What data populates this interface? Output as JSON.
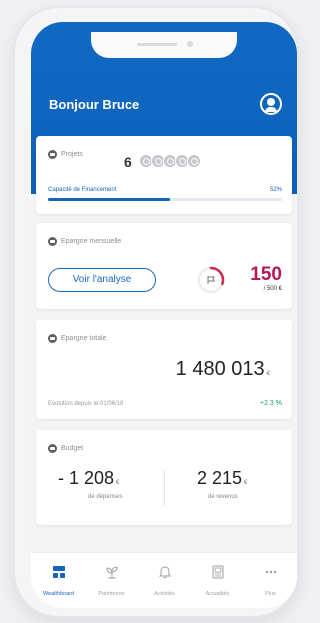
{
  "header": {
    "greeting": "Bonjour Bruce"
  },
  "projets": {
    "title": "Projets",
    "count": "6",
    "capacity_label": "Capacité de Financement",
    "capacity_pct": "52%",
    "capacity_fraction": 0.52
  },
  "epargne_mensuelle": {
    "title": "Epargne mensuelle",
    "button_label": "Voir l'analyse",
    "value": "150",
    "target": "/ 500 €",
    "progress_fraction": 0.3
  },
  "epargne_totale": {
    "title": "Epargne totale",
    "value": "1 480 013",
    "unit": "€",
    "evolution_label": "Evolution depuis le 01/06/18",
    "evolution_value": "+2.3 %"
  },
  "budget": {
    "title": "Budget",
    "depenses_value": "- 1 208",
    "depenses_unit": "€",
    "depenses_label": "de dépenses",
    "revenus_value": "2 215",
    "revenus_unit": "€",
    "revenus_label": "de revenus"
  },
  "tabs": [
    {
      "label": "Wealthboard",
      "icon": "dashboard-icon"
    },
    {
      "label": "Patrimoine",
      "icon": "plant-icon"
    },
    {
      "label": "Activités",
      "icon": "bell-icon"
    },
    {
      "label": "Actualités",
      "icon": "news-icon"
    },
    {
      "label": "Plus",
      "icon": "more-icon"
    }
  ],
  "colors": {
    "primary": "#1464bd",
    "accent": "#b61757",
    "positive": "#1c9b62"
  }
}
